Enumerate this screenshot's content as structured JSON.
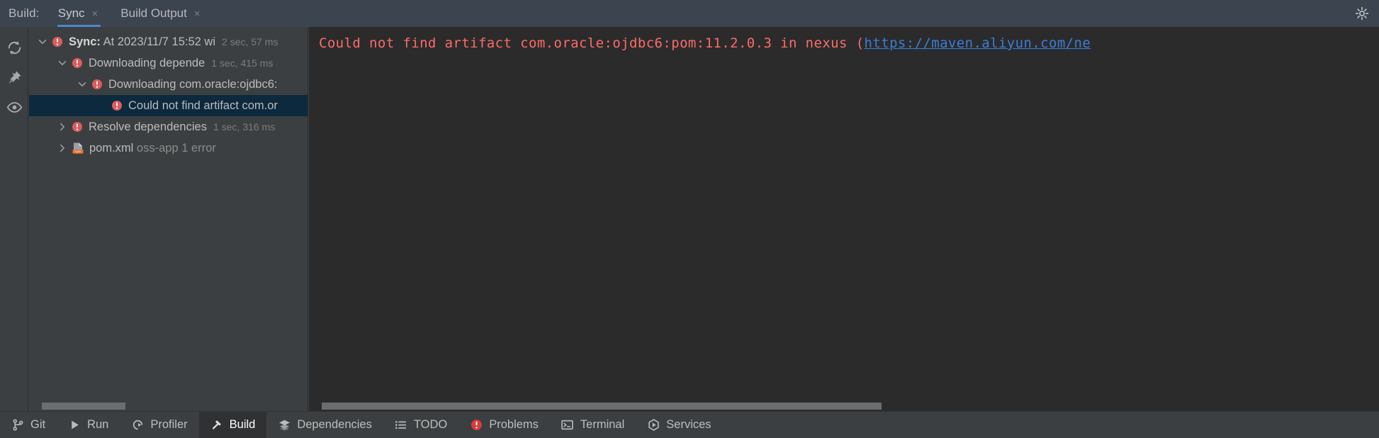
{
  "header": {
    "label": "Build:",
    "tabs": [
      {
        "name": "sync",
        "label": "Sync",
        "close": "×",
        "active": true
      },
      {
        "name": "build-output",
        "label": "Build Output",
        "close": "×",
        "active": false
      }
    ],
    "settings_icon": "gear-icon"
  },
  "rail": {
    "items": [
      {
        "name": "refresh-icon",
        "label": "Refresh"
      },
      {
        "name": "pin-icon",
        "label": "Pin"
      },
      {
        "name": "eye-icon",
        "label": "Toggle visibility"
      }
    ]
  },
  "tree": {
    "rows": [
      {
        "name": "tree-row-sync",
        "indent": 0,
        "twisty": "expanded",
        "icon": "error-icon",
        "bold": "Sync:",
        "text": " At 2023/11/7 15:52 wi",
        "time": "2 sec, 57 ms",
        "selected": false
      },
      {
        "name": "tree-row-downloading-dependencies",
        "indent": 1,
        "twisty": "expanded",
        "icon": "error-icon",
        "bold": "",
        "text": "Downloading depende",
        "time": "1 sec, 415 ms",
        "selected": false
      },
      {
        "name": "tree-row-downloading-ojdbc6",
        "indent": 2,
        "twisty": "expanded",
        "icon": "error-icon",
        "bold": "",
        "text": "Downloading com.oracle:ojdbc6:",
        "time": "",
        "selected": false
      },
      {
        "name": "tree-row-could-not-find-artifact",
        "indent": 3,
        "twisty": "none",
        "icon": "error-icon",
        "bold": "",
        "text": "Could not find artifact com.or",
        "time": "",
        "selected": true
      },
      {
        "name": "tree-row-resolve-dependencies",
        "indent": 1,
        "twisty": "collapsed",
        "icon": "error-icon",
        "bold": "",
        "text": "Resolve dependencies",
        "time": "1 sec, 316 ms",
        "selected": false
      },
      {
        "name": "tree-row-pom-xml",
        "indent": 1,
        "twisty": "collapsed",
        "icon": "xml-file-icon",
        "bold": "",
        "text": "pom.xml",
        "subtext": " oss-app 1 error",
        "time": "",
        "selected": false
      }
    ]
  },
  "console": {
    "message_prefix": "Could not find artifact com.oracle:ojdbc6:pom:11.2.0.3 in nexus (",
    "link": "https://maven.aliyun.com/ne"
  },
  "statusbar": {
    "items": [
      {
        "name": "statusbar-item-git",
        "label": "Git",
        "icon": "git-branch-icon",
        "active": false
      },
      {
        "name": "statusbar-item-run",
        "label": "Run",
        "icon": "play-icon",
        "active": false
      },
      {
        "name": "statusbar-item-profiler",
        "label": "Profiler",
        "icon": "profiler-icon",
        "active": false
      },
      {
        "name": "statusbar-item-build",
        "label": "Build",
        "icon": "hammer-icon",
        "active": true
      },
      {
        "name": "statusbar-item-dependencies",
        "label": "Dependencies",
        "icon": "layers-icon",
        "active": false
      },
      {
        "name": "statusbar-item-todo",
        "label": "TODO",
        "icon": "list-icon",
        "active": false
      },
      {
        "name": "statusbar-item-problems",
        "label": "Problems",
        "icon": "error-icon",
        "active": false
      },
      {
        "name": "statusbar-item-terminal",
        "label": "Terminal",
        "icon": "terminal-icon",
        "active": false
      },
      {
        "name": "statusbar-item-services",
        "label": "Services",
        "icon": "services-icon",
        "active": false
      }
    ]
  },
  "colors": {
    "error_red": "#db5c5c",
    "link_blue": "#3a7ddc",
    "accent_blue": "#4a88c7",
    "console_text": "#ff6b68",
    "selection": "#0d293e"
  }
}
